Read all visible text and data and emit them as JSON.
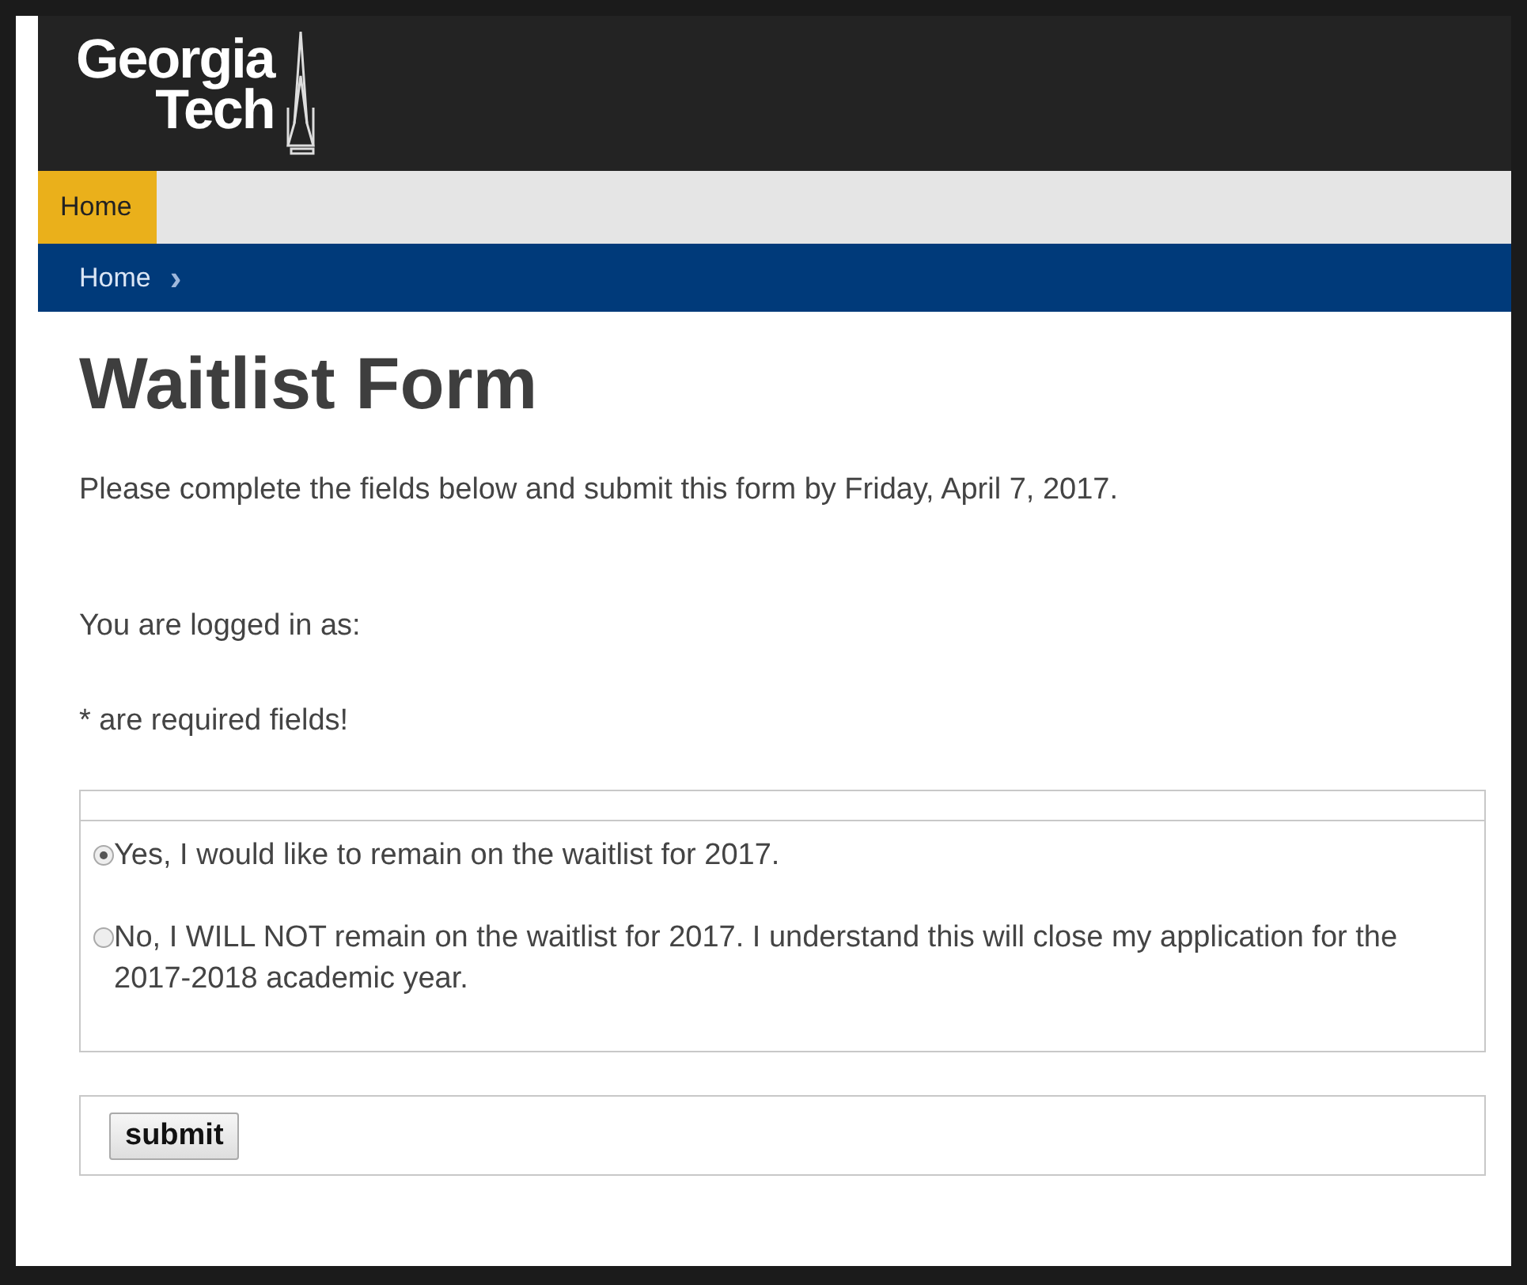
{
  "logo": {
    "line_1": "Georgia",
    "line_2": "Tech"
  },
  "nav": {
    "tabs": [
      {
        "label": "Home",
        "selected": true
      }
    ]
  },
  "breadcrumb": {
    "items": [
      "Home"
    ],
    "separator": "›"
  },
  "title": "Waitlist Form",
  "intro": "Please complete the fields below and submit this form by Friday, April 7, 2017.",
  "logged_in_label": "You are logged in as:",
  "required_note": "* are required fields!",
  "options": [
    {
      "label": "Yes, I would like to remain on the waitlist for 2017.",
      "selected": true
    },
    {
      "label": "No, I WILL NOT remain on the waitlist for 2017. I understand this will close my application for the 2017-2018 academic year.",
      "selected": false
    }
  ],
  "submit": "submit"
}
